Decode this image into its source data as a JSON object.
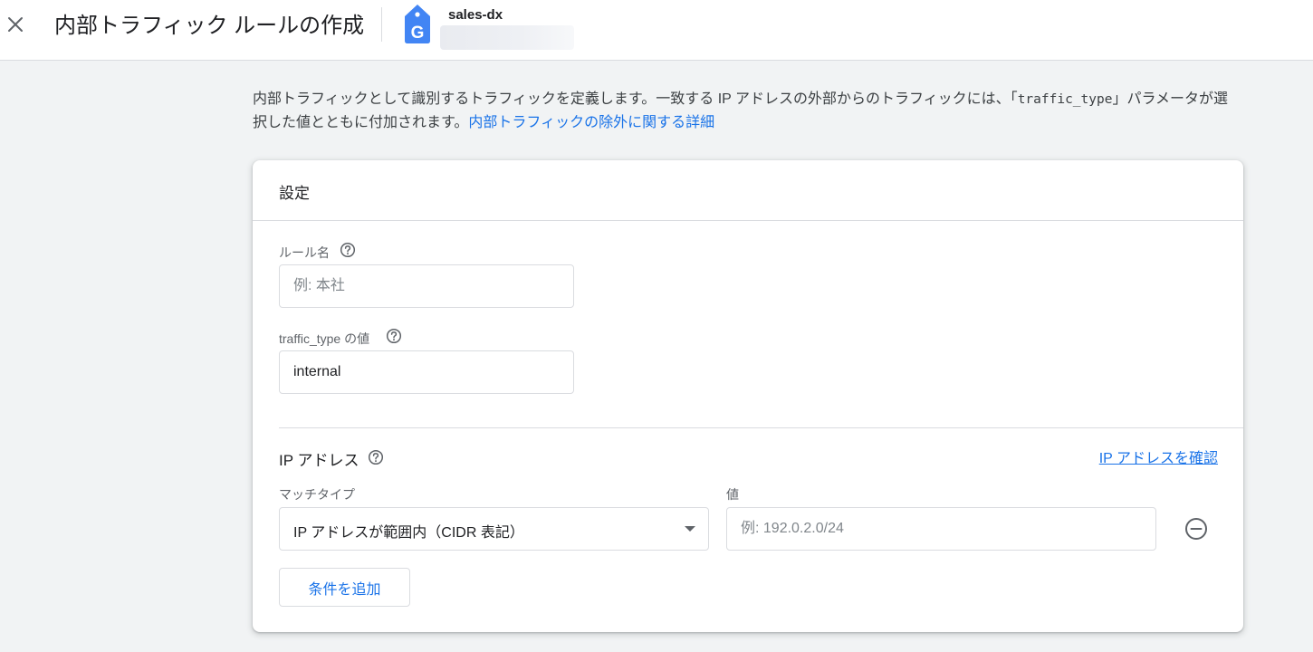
{
  "header": {
    "title": "内部トラフィック ルールの作成",
    "property_name": "sales-dx",
    "close_icon": "close-icon",
    "logo_icon": "google-tag-icon",
    "logo_letter": "G",
    "logo_color": "#4285f4"
  },
  "intro": {
    "text_before": "内部トラフィックとして識別するトラフィックを定義します。一致する IP アドレスの外部からのトラフィックには、「",
    "code": "traffic_type",
    "text_after": "」パラメータが選択した値とともに付加されます。",
    "link": "内部トラフィックの除外に関する詳細"
  },
  "settings": {
    "title": "設定",
    "rule_name": {
      "label": "ルール名",
      "placeholder": "例: 本社",
      "value": ""
    },
    "traffic_type": {
      "label": "traffic_type の値",
      "value": "internal"
    }
  },
  "ip_section": {
    "title": "IP アドレス",
    "check_link": "IP アドレスを確認",
    "match_type_label": "マッチタイプ",
    "match_type_value": "IP アドレスが範囲内（CIDR 表記）",
    "value_label": "値",
    "value_placeholder": "例: 192.0.2.0/24",
    "add_condition": "条件を追加"
  },
  "colors": {
    "accent": "#1a73e8",
    "background": "#f1f3f4",
    "text_primary": "#202124",
    "text_secondary": "#5f6368",
    "border": "#dadce0"
  }
}
